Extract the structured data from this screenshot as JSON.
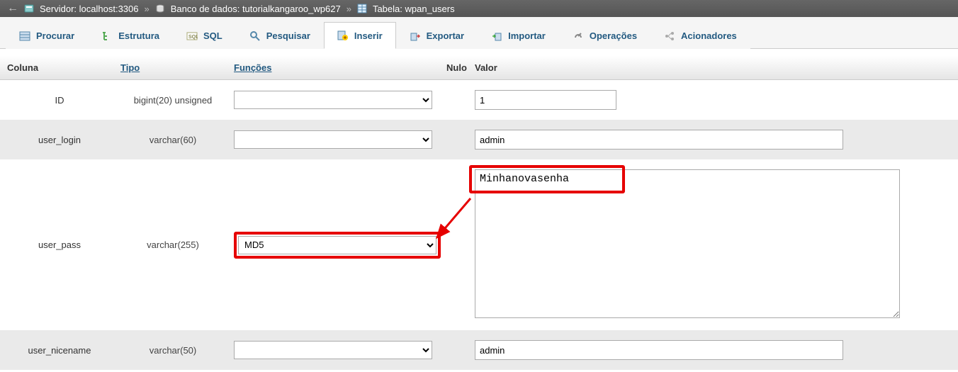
{
  "breadcrumb": {
    "server_label": "Servidor:",
    "server_value": "localhost:3306",
    "db_label": "Banco de dados:",
    "db_value": "tutorialkangaroo_wp627",
    "table_label": "Tabela:",
    "table_value": "wpan_users"
  },
  "tabs": {
    "browse": "Procurar",
    "structure": "Estrutura",
    "sql": "SQL",
    "search": "Pesquisar",
    "insert": "Inserir",
    "export": "Exportar",
    "import": "Importar",
    "operations": "Operações",
    "triggers": "Acionadores"
  },
  "headers": {
    "column": "Coluna",
    "type": "Tipo",
    "function": "Funções",
    "null": "Nulo",
    "value": "Valor"
  },
  "rows": {
    "id": {
      "name": "ID",
      "type": "bigint(20) unsigned",
      "func": "",
      "value": "1"
    },
    "login": {
      "name": "user_login",
      "type": "varchar(60)",
      "func": "",
      "value": "admin"
    },
    "pass": {
      "name": "user_pass",
      "type": "varchar(255)",
      "func": "MD5",
      "value": "Minhanovasenha"
    },
    "nicename": {
      "name": "user_nicename",
      "type": "varchar(50)",
      "func": "",
      "value": "admin"
    }
  },
  "function_options": [
    "",
    "MD5"
  ],
  "colors": {
    "link": "#235a81",
    "highlight": "#e60000"
  }
}
